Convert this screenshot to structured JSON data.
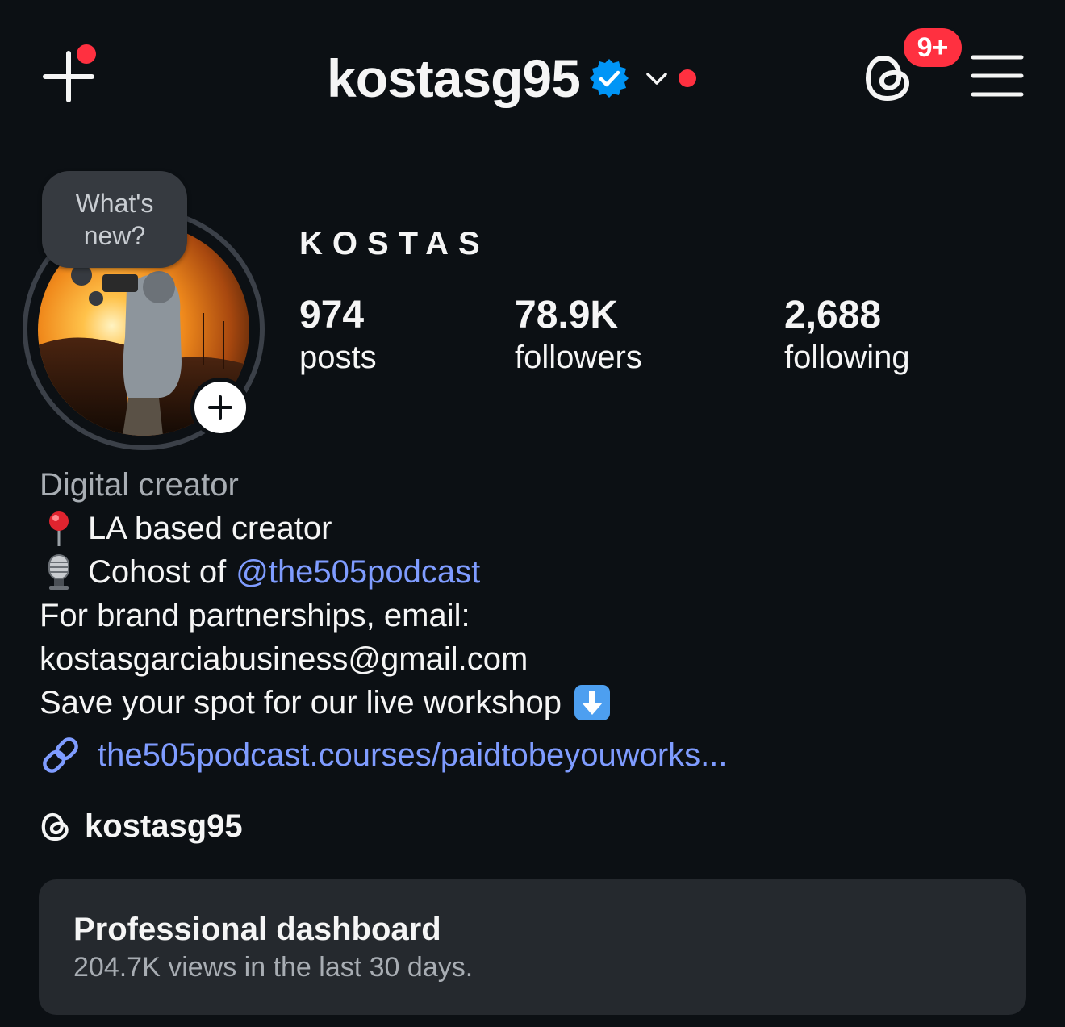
{
  "header": {
    "username": "kostasg95",
    "notification_count": "9+",
    "icons": {
      "create": "plus-icon",
      "verified": "verified-badge-icon",
      "switch_account": "chevron-down-icon",
      "threads": "threads-icon",
      "menu": "hamburger-menu-icon"
    }
  },
  "profile": {
    "note_prompt": "What's new?",
    "display_name": "KOSTAS",
    "stats": [
      {
        "value": "974",
        "label": "posts"
      },
      {
        "value": "78.9K",
        "label": "followers"
      },
      {
        "value": "2,688",
        "label": "following"
      }
    ]
  },
  "bio": {
    "category": "Digital creator",
    "line1_emoji": "round-pushpin-icon",
    "line1": "LA based creator",
    "line2_emoji": "microphone-icon",
    "line2_prefix": "Cohost of",
    "line2_mention": "@the505podcast",
    "line3": "For brand partnerships, email:",
    "line4": "kostasgarciabusiness@gmail.com",
    "line5": "Save your spot for our live workshop",
    "line5_emoji": "down-arrow-button-icon",
    "link": "the505podcast.courses/paidtobeyouworks...",
    "threads_handle": "kostasg95"
  },
  "dashboard": {
    "title": "Professional dashboard",
    "subtitle": "204.7K views in the last 30 days."
  },
  "colors": {
    "background": "#0c1014",
    "text": "#f5f5f5",
    "muted": "#a8adb3",
    "link": "#7f9cff",
    "badge": "#ff3040",
    "verified": "#0095f6",
    "card": "#25292e"
  }
}
